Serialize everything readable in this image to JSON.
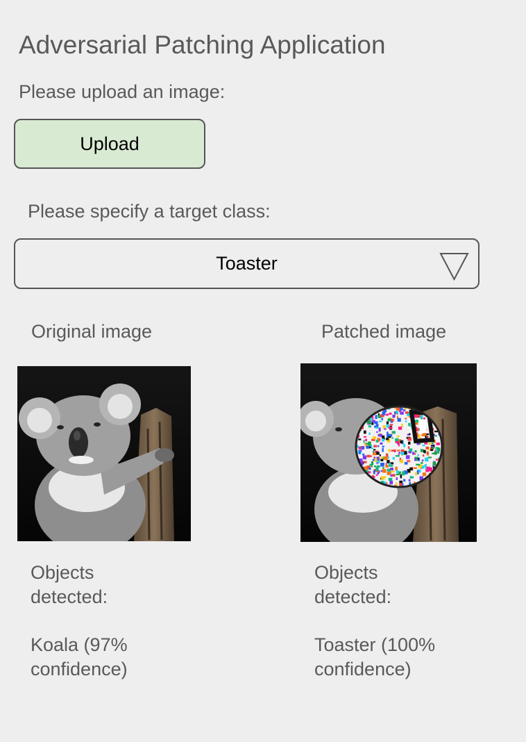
{
  "app": {
    "title": "Adversarial Patching Application"
  },
  "upload": {
    "prompt": "Please upload an image:",
    "button_label": "Upload"
  },
  "target": {
    "prompt": "Please specify a target class:",
    "selected": "Toaster"
  },
  "original": {
    "heading": "Original image",
    "objects_label_line1": "Objects",
    "objects_label_line2": "detected:",
    "result_line1": "Koala (97%",
    "result_line2": "confidence)"
  },
  "patched": {
    "heading": "Patched image",
    "objects_label_line1": "Objects",
    "objects_label_line2": "detected:",
    "result_line1": "Toaster (100%",
    "result_line2": "confidence)"
  },
  "colors": {
    "background": "#eeeeee",
    "text": "#595959",
    "upload_button": "#d9ead3",
    "border": "#555555"
  },
  "icons": {
    "dropdown": "triangle-down-icon"
  }
}
